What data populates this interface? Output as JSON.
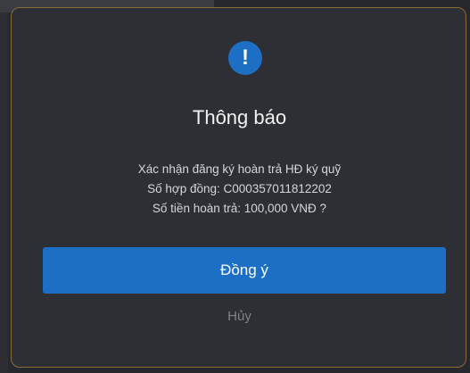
{
  "dialog": {
    "icon": "exclamation-icon",
    "icon_glyph": "!",
    "title": "Thông báo",
    "message_lines": [
      "Xác nhận đăng ký hoàn trả HĐ ký quỹ",
      "Số hợp đồng: C000357011812202",
      "Số tiền hoàn trả: 100,000 VNĐ ?"
    ],
    "confirm_label": "Đồng ý",
    "cancel_label": "Hủy"
  },
  "colors": {
    "accent": "#1c6fc4",
    "dialog_bg": "#2d2f34",
    "border": "#8a6b3a"
  }
}
